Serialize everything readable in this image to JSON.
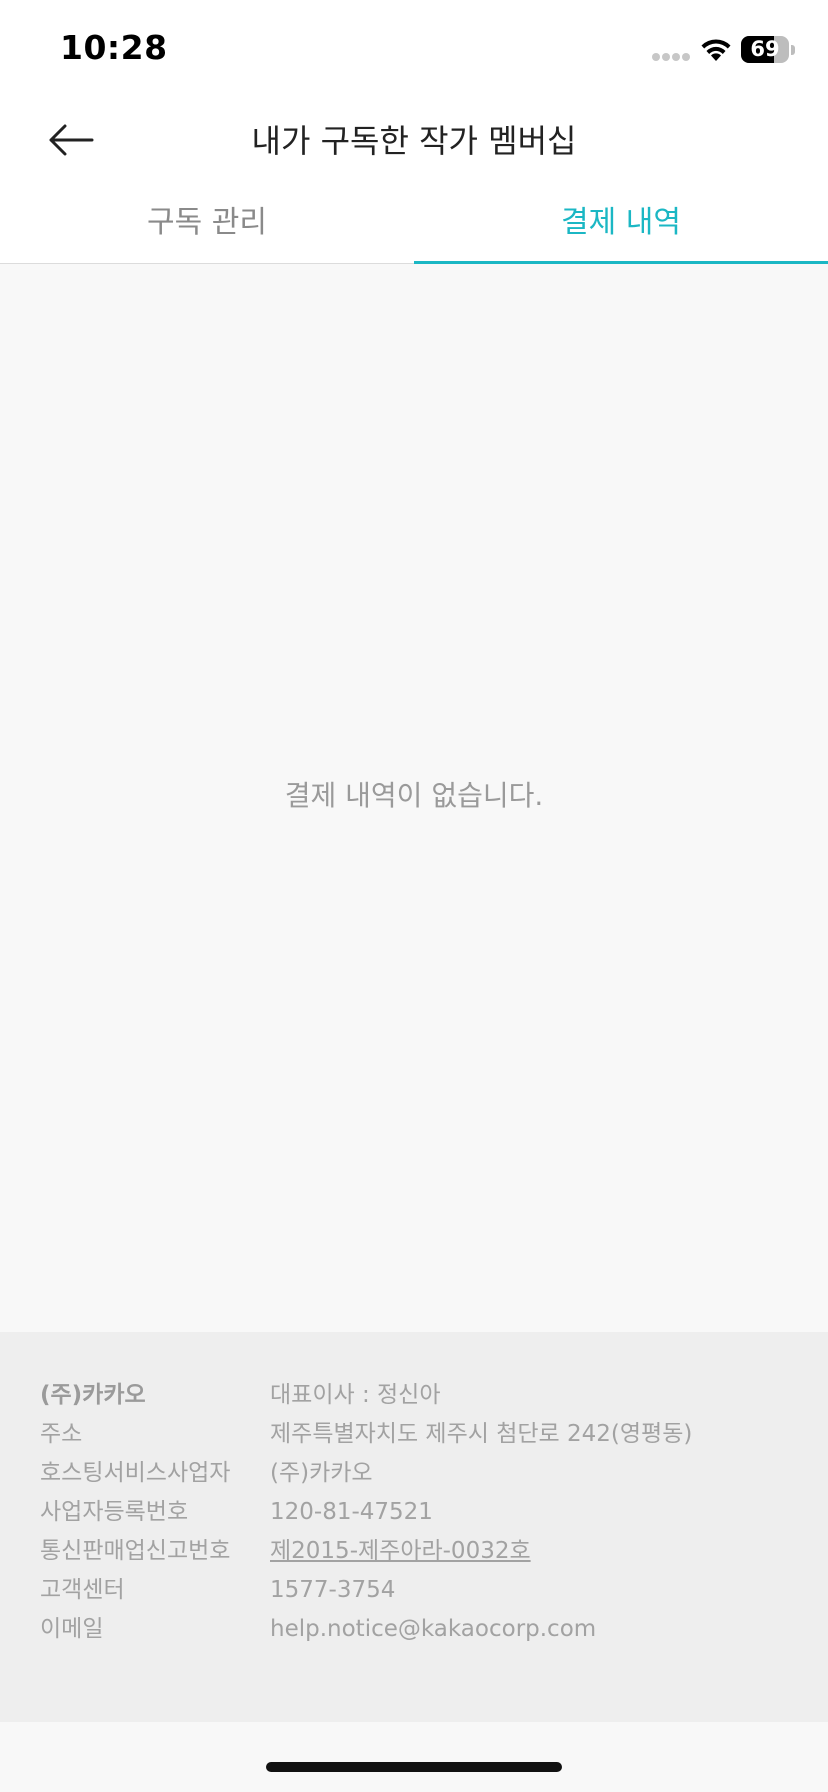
{
  "status_bar": {
    "time": "10:28",
    "battery_percent": "69",
    "battery_level": 0.69
  },
  "header": {
    "title": "내가 구독한 작가 멤버십",
    "back_icon": "arrow-left-icon"
  },
  "tabs": [
    {
      "label": "구독 관리",
      "active": false
    },
    {
      "label": "결제 내역",
      "active": true
    }
  ],
  "colors": {
    "accent": "#1bb7c4",
    "tab_inactive": "#8a8a8a",
    "background": "#f8f8f8",
    "footer_background": "#eeeeee"
  },
  "empty_state": {
    "message": "결제 내역이 없습니다."
  },
  "footer": {
    "company": "(주)카카오",
    "ceo": "대표이사 : 정신아",
    "rows": [
      {
        "label": "주소",
        "value": "제주특별자치도 제주시 첨단로 242(영평동)"
      },
      {
        "label": "호스팅서비스사업자",
        "value": "(주)카카오"
      },
      {
        "label": "사업자등록번호",
        "value": "120-81-47521"
      },
      {
        "label": "통신판매업신고번호",
        "value": "제2015-제주아라-0032호"
      },
      {
        "label": "고객센터",
        "value": "1577-3754"
      },
      {
        "label": "이메일",
        "value": "help.notice@kakaocorp.com"
      }
    ]
  }
}
